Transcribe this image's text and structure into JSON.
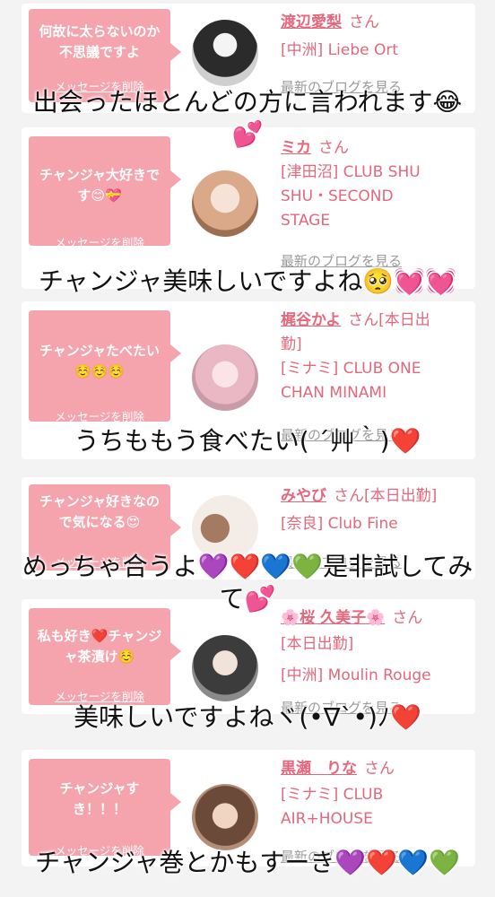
{
  "cards": [
    {
      "message": "何故に太らないのか不思議ですよ",
      "delete": "メッセージを削除",
      "name": "渡辺愛梨",
      "san": "さん",
      "lines": [
        "[中洲] Liebe Ort"
      ],
      "blog": "最新のブログを見る",
      "caption": "出会ったほとんどの方に言われます😂💕",
      "avatar_colors": [
        "#2b2b2b",
        "#d9d9d9"
      ]
    },
    {
      "message": "チャンジャ大好きです😊💝",
      "delete": "メッセージを削除",
      "name": "ミカ",
      "san": "さん",
      "lines": [
        "[津田沼] CLUB SHU",
        "SHU・SECOND",
        "STAGE"
      ],
      "blog": "最新のブログを見る",
      "caption": "チャンジャ美味しいですよね🥺💓💓",
      "avatar_colors": [
        "#f2d7c4",
        "#c48f6d"
      ]
    },
    {
      "message": "チャンジャたべたい☺️☺️☺️",
      "delete": "メッセージを削除",
      "name": "梶谷かよ",
      "san": "さん[本日出",
      "lines": [
        "勤]",
        "[ミナミ] CLUB ONE",
        "CHAN MINAMI"
      ],
      "blog": "最新のブログを見る",
      "caption": "うちももう食べたい( ´艸｀)❤️",
      "avatar_colors": [
        "#f7d3da",
        "#d8a8b8"
      ]
    },
    {
      "message": "チャンジャ好きなので気になる😍",
      "delete": "メッセージを削除",
      "name": "みやび",
      "san": "さん[本日出勤]",
      "lines": [
        "[奈良] Club Fine"
      ],
      "blog": "最新のブログを見る",
      "caption": "めっちゃ合うよ💜❤️💙💚是非試してみて💕",
      "avatar_colors": [
        "#f4ece6",
        "#a57a63"
      ]
    },
    {
      "message": "私も好き❤️チャンジャ茶漬け☺️",
      "delete": "メッセージを削除",
      "name": "🌸桜 久美子🌸",
      "san": "さん",
      "lines": [
        "[本日出勤]",
        "[中洲] Moulin Rouge"
      ],
      "blog": "最新のブログを見る",
      "caption": "美味しいですよねヾ(•∇`•)ﾉ❤️",
      "avatar_colors": [
        "#3c3c3c",
        "#e8e8e8"
      ]
    },
    {
      "message": "チャンジャすき！！！",
      "delete": "メッセージを削除",
      "name": "黒瀬　りな",
      "san": "さん",
      "lines": [
        "[ミナミ] CLUB",
        "AIR+HOUSE"
      ],
      "blog": "最新のブログを見る",
      "caption": "チャンジャ巻とかもすーき💜❤️💙💚",
      "avatar_colors": [
        "#6b4a3a",
        "#e9cdb9"
      ]
    }
  ]
}
